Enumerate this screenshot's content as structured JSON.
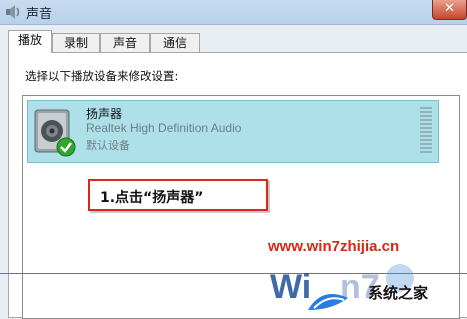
{
  "window": {
    "title": "声音",
    "close_label": "✕"
  },
  "tabs": [
    {
      "label": "播放",
      "active": true
    },
    {
      "label": "录制",
      "active": false
    },
    {
      "label": "声音",
      "active": false
    },
    {
      "label": "通信",
      "active": false
    }
  ],
  "panel": {
    "hint": "选择以下播放设备来修改设置:"
  },
  "devices": [
    {
      "name": "扬声器",
      "description": "Realtek High Definition Audio",
      "status": "默认设备",
      "icon": "speaker-icon",
      "badge_icon": "check-icon",
      "selected": true
    }
  ],
  "annotation": {
    "text": "1.点击“扬声器”",
    "border_color": "#d9271c"
  },
  "watermark": {
    "url": "www.win7zhijia.cn",
    "site": "系统之家"
  },
  "colors": {
    "selection": "#aee0ea",
    "accent_red": "#d62716"
  }
}
